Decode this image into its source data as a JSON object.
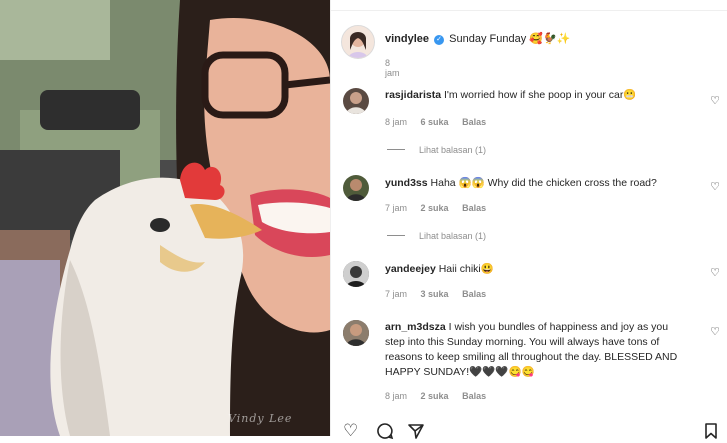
{
  "post": {
    "username": "vindylee",
    "caption": "Sunday Funday",
    "caption_emojis": "🥰🐓✨",
    "time": "8 jam",
    "watermark": "Vindy Lee"
  },
  "comments": [
    {
      "username": "rasjidarista",
      "text": "I'm worried how if she poop in your car😬",
      "time": "8 jam",
      "likes": "6 suka",
      "reply": "Balas",
      "view_replies": "Lihat balasan (1)",
      "avatar_color": "#5a4a42"
    },
    {
      "username": "yund3ss",
      "text": "Haha 😱😱 Why did the chicken cross the road?",
      "time": "7 jam",
      "likes": "2 suka",
      "reply": "Balas",
      "view_replies": "Lihat balasan (1)",
      "avatar_color": "#4f5b3a"
    },
    {
      "username": "yandeejey",
      "text": "Haii chiki😃",
      "time": "7 jam",
      "likes": "3 suka",
      "reply": "Balas",
      "avatar_color": "#6b6b6b"
    },
    {
      "username": "arn_m3dsza",
      "text": "I wish you bundles of happiness and joy as you step into this Sunday morning. You will always have tons of reasons to keep smiling all throughout the day. BLESSED AND HAPPY SUNDAY!🖤🖤🖤😋😋",
      "time": "8 jam",
      "likes": "2 suka",
      "reply": "Balas",
      "avatar_color": "#3f3a36"
    }
  ],
  "actions": {
    "like_icon": "heart-outline-icon",
    "comment_icon": "comment-bubble-icon",
    "share_icon": "paper-plane-icon",
    "save_icon": "bookmark-icon"
  }
}
